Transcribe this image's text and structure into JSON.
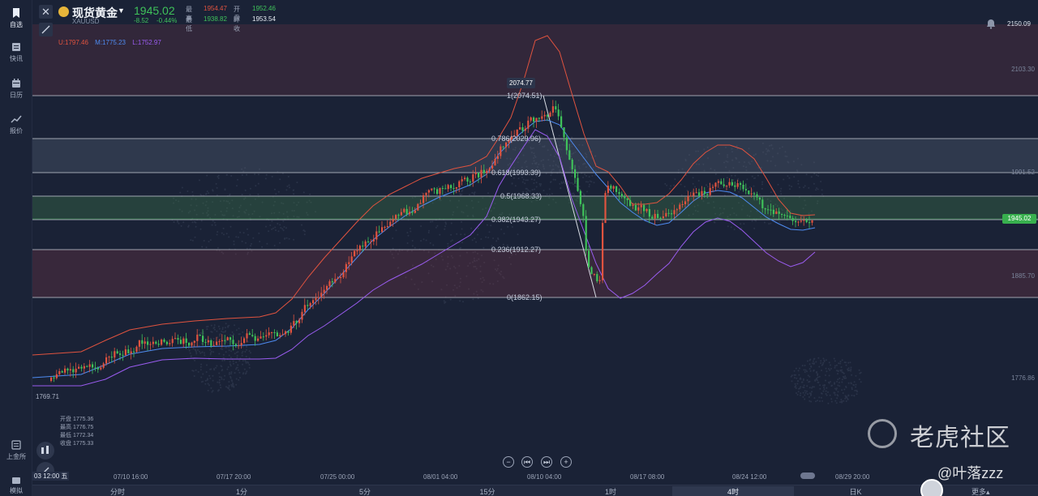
{
  "sidebar": {
    "items": [
      {
        "label": "自选",
        "icon": "bookmark-icon"
      },
      {
        "label": "快讯",
        "icon": "news-icon"
      },
      {
        "label": "日历",
        "icon": "calendar-icon"
      },
      {
        "label": "报价",
        "icon": "trend-icon"
      }
    ],
    "bottom": [
      {
        "label": "上金所",
        "icon": "exchange-icon"
      },
      {
        "label": "模拟",
        "icon": "simulate-icon"
      }
    ]
  },
  "header": {
    "title": "现货黄金",
    "code": "XAUUSD",
    "price": "1945.02",
    "change": "-8.52",
    "change_pct": "-0.44%",
    "high_label": "最高",
    "high": "1954.47",
    "open_label": "开盘",
    "open": "1952.46",
    "low_label": "最低",
    "low": "1938.82",
    "prev_label": "昨收",
    "prev": "1953.54"
  },
  "bollinger": {
    "upper": "U:1797.46",
    "middle": "M:1775.23",
    "lower": "L:1752.97",
    "upper_color": "#e0533f",
    "middle_color": "#4e8bf0",
    "lower_color": "#9a5cf0"
  },
  "price_axis": {
    "top": "2150.09",
    "levels": [
      "2103.30",
      "1991.52",
      "1885.70",
      "1776.86"
    ],
    "current": "1945.02"
  },
  "fib": {
    "peak": "2074.77",
    "labels": [
      "1(2074.51)",
      "0.786(2029.96)",
      "0.618(1993.39)",
      "0.5(1968.33)",
      "0.382(1943.27)",
      "0.236(1912.27)",
      "0(1862.15)"
    ]
  },
  "low_tag": "1769.71",
  "bottom_ohlc": {
    "lines": [
      "开盘 1775.36",
      "最高 1776.75",
      "最低 1772.34",
      "收盘 1775.33"
    ]
  },
  "controls": [
    "−",
    "⏮",
    "⏭",
    "+"
  ],
  "time_axis": {
    "first": "03 12:00 五",
    "labels": [
      "07/10 16:00",
      "07/17 20:00",
      "07/25 00:00",
      "08/01 04:00",
      "08/10 04:00",
      "08/17 08:00",
      "08/24 12:00",
      "08/29 20:00"
    ]
  },
  "timeframes": {
    "items": [
      "分时",
      "1分",
      "5分",
      "15分",
      "1时",
      "4时",
      "日K"
    ],
    "active": "4时",
    "more": "更多▴"
  },
  "watermark": {
    "brand": "老虎社区",
    "user": "@叶落zzz"
  },
  "colors": {
    "up": "#e0533f",
    "down": "#3fc25a",
    "background": "#1a2236"
  }
}
